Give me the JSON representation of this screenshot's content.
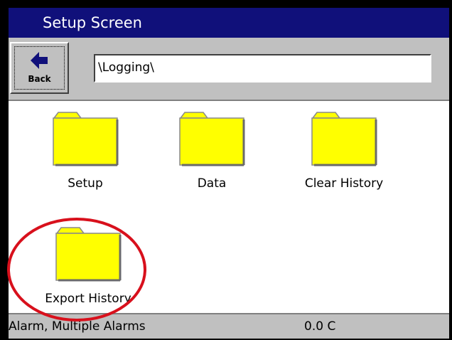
{
  "window": {
    "title": "Setup Screen"
  },
  "toolbar": {
    "back_label": "Back",
    "path_value": "\\Logging\\"
  },
  "folders": [
    {
      "label": "Setup"
    },
    {
      "label": "Data"
    },
    {
      "label": "Clear History"
    },
    {
      "label": "Export History"
    }
  ],
  "status": {
    "alarm_text": "Alarm, Multiple Alarms",
    "temperature": "0.0 C"
  },
  "colors": {
    "title_bar": "#10107a",
    "folder_fill": "#ffff00",
    "annotation": "#d8101c",
    "chrome": "#c0c0c0"
  },
  "icons": {
    "back": "back-arrow-icon",
    "folder": "folder-icon"
  }
}
